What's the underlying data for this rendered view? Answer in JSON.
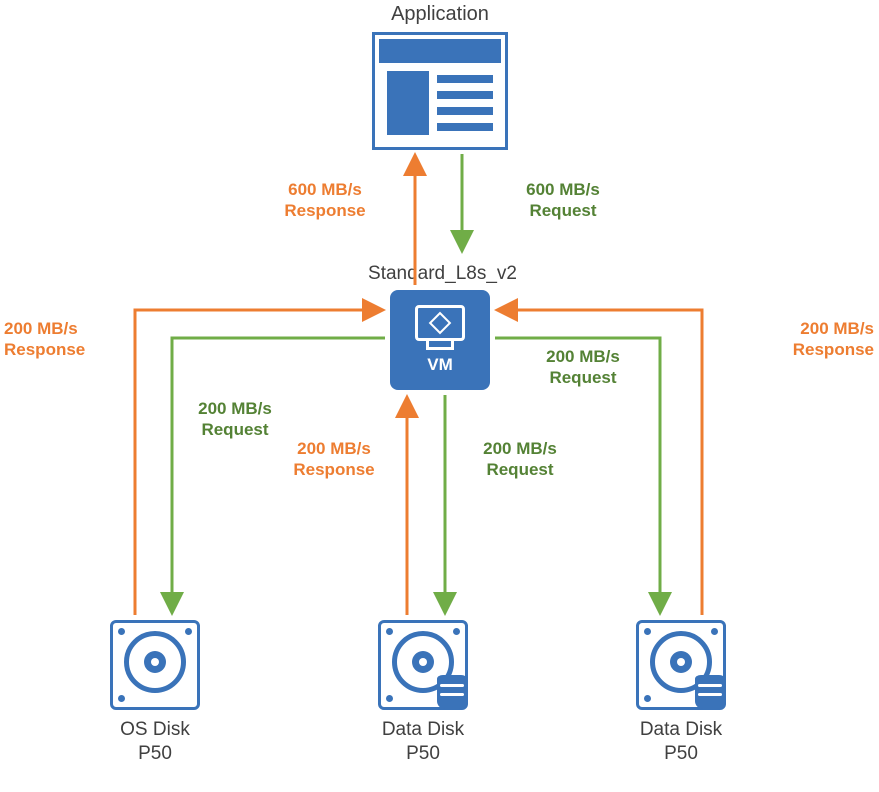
{
  "title_application": "Application",
  "title_vm": "Standard_L8s_v2",
  "vm_box_label": "VM",
  "flows": {
    "app_response": {
      "rate": "600 MB/s",
      "kind": "Response"
    },
    "app_request": {
      "rate": "600 MB/s",
      "kind": "Request"
    },
    "left_response": {
      "rate": "200 MB/s",
      "kind": "Response"
    },
    "left_request": {
      "rate": "200 MB/s",
      "kind": "Request"
    },
    "mid_response": {
      "rate": "200 MB/s",
      "kind": "Response"
    },
    "mid_request": {
      "rate": "200 MB/s",
      "kind": "Request"
    },
    "right_response": {
      "rate": "200 MB/s",
      "kind": "Response"
    },
    "right_request": {
      "rate": "200 MB/s",
      "kind": "Request"
    }
  },
  "disks": {
    "os": {
      "name": "OS Disk",
      "sku": "P50"
    },
    "data1": {
      "name": "Data Disk",
      "sku": "P50"
    },
    "data2": {
      "name": "Data Disk",
      "sku": "P50"
    }
  },
  "colors": {
    "request": "#70ad47",
    "response": "#ed7d31",
    "brand": "#3a73b9"
  }
}
